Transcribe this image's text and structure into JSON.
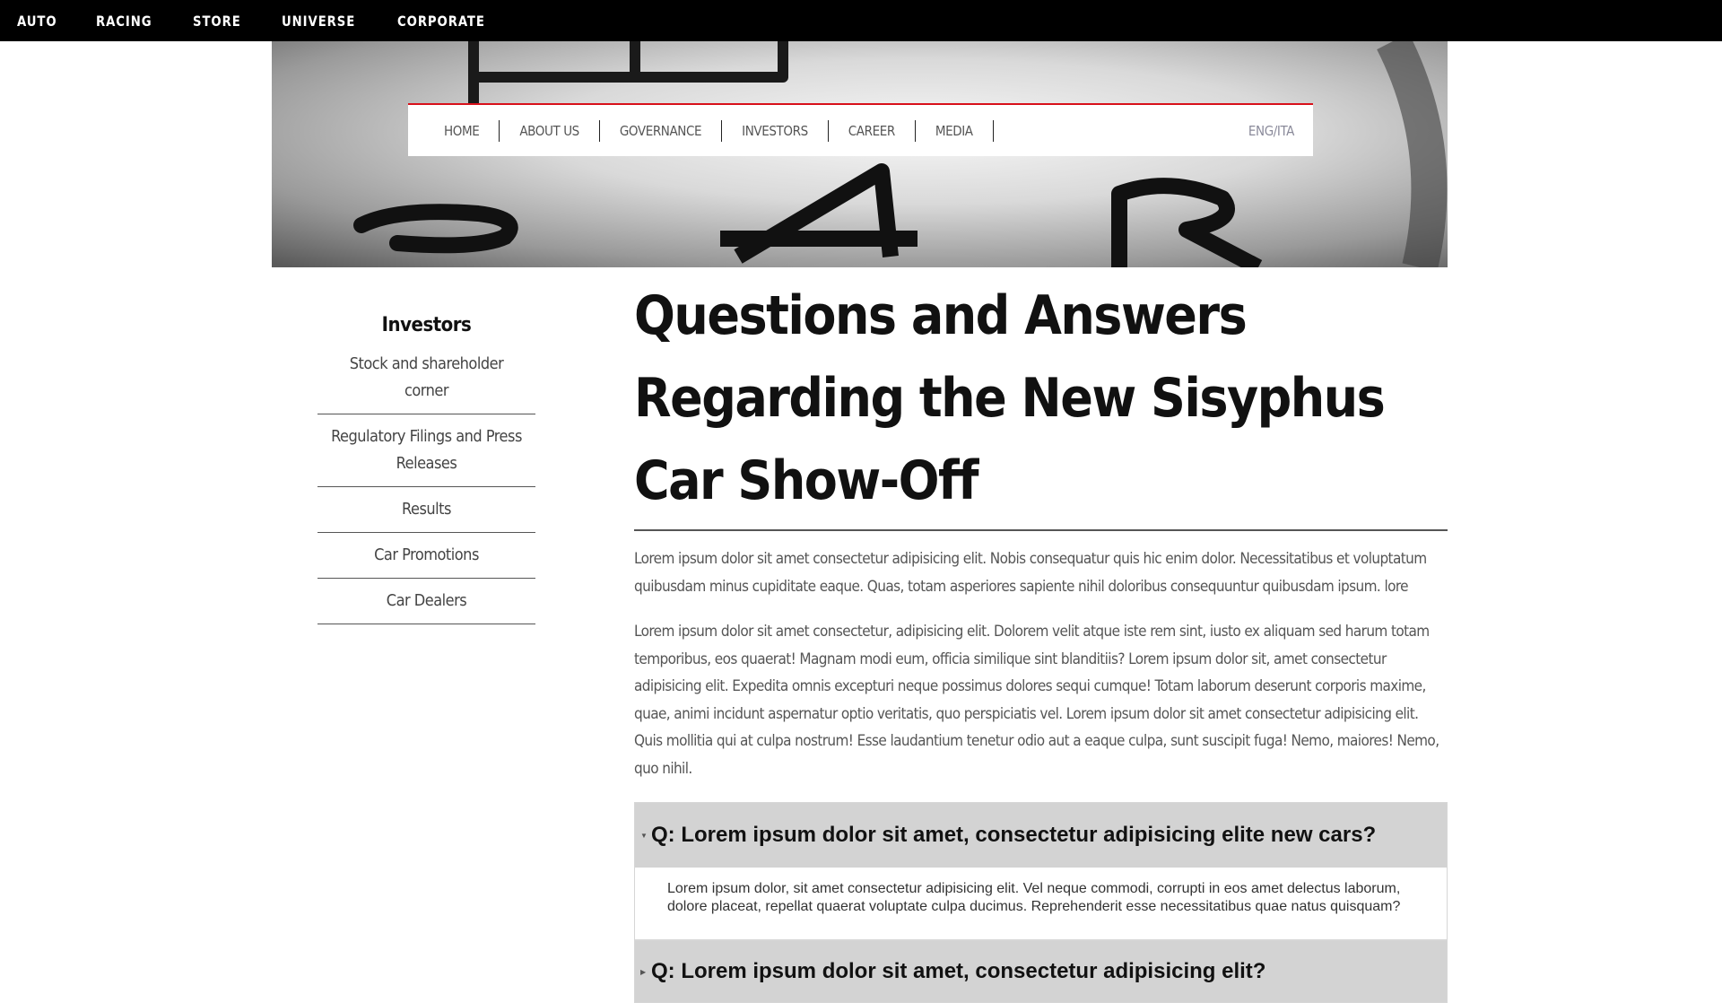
{
  "top_nav": {
    "links": [
      "AUTO",
      "RACING",
      "STORE",
      "UNIVERSE",
      "CORPORATE"
    ]
  },
  "sub_nav": {
    "items": [
      "HOME",
      "ABOUT US",
      "GOVERNANCE",
      "INVESTORS",
      "CAREER",
      "MEDIA"
    ],
    "language": "ENG/ITA"
  },
  "sidebar": {
    "title": "Investors",
    "items": [
      "Stock and shareholder corner",
      "Regulatory Filings and Press Releases",
      "Results",
      "Car Promotions",
      "Car Dealers"
    ]
  },
  "main": {
    "title": "Questions and Answers Regarding the New Sisyphus Car Show-Off",
    "paragraphs": [
      "Lorem ipsum dolor sit amet consectetur adipisicing elit. Nobis consequatur quis hic enim dolor. Necessitatibus et voluptatum quibusdam minus cupiditate eaque. Quas, totam asperiores sapiente nihil doloribus consequuntur quibusdam ipsum. lore",
      "Lorem ipsum dolor sit amet consectetur, adipisicing elit. Dolorem velit atque iste rem sint, iusto ex aliquam sed harum totam temporibus, eos quaerat! Magnam modi eum, officia similique sint blanditiis? Lorem ipsum dolor sit, amet consectetur adipisicing elit. Expedita omnis excepturi neque possimus dolores sequi cumque! Totam laborum deserunt corporis maxime, quae, animi incidunt aspernatur optio veritatis, quo perspiciatis vel. Lorem ipsum dolor sit amet consectetur adipisicing elit. Quis mollitia qui at culpa nostrum! Esse laudantium tenetur odio aut a eaque culpa, sunt suscipit fuga! Nemo, maiores! Nemo, quo nihil."
    ],
    "faq": [
      {
        "question": "Q: Lorem ipsum dolor sit amet, consectetur adipisicing elite new cars?",
        "answer": "Lorem ipsum dolor, sit amet consectetur adipisicing elit. Vel neque commodi, corrupti in eos amet delectus laborum, dolore placeat, repellat quaerat voluptate culpa ducimus. Reprehenderit esse necessitatibus quae natus quisquam?",
        "expanded": true
      },
      {
        "question": "Q: Lorem ipsum dolor sit amet, consectetur adipisicing elit?",
        "answer": "",
        "expanded": false
      }
    ]
  },
  "icons": {
    "expanded_caret": "caret-down-icon",
    "collapsed_caret": "caret-right-icon"
  },
  "colors": {
    "topbar_bg": "#000000",
    "accent_red": "#d8101a",
    "faq_header_bg": "#d3d3d3"
  }
}
